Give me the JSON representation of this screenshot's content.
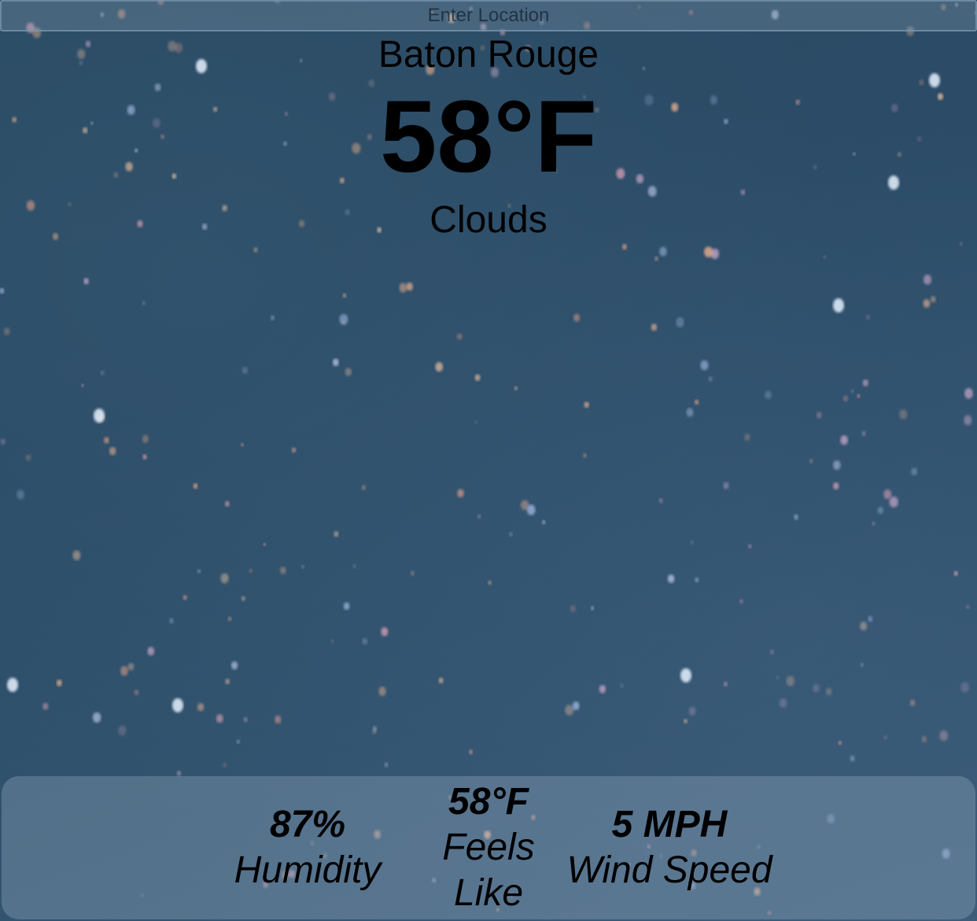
{
  "search": {
    "placeholder": "Enter Location",
    "value": ""
  },
  "weather": {
    "city": "Baton Rouge",
    "temperature": "58°F",
    "description": "Clouds"
  },
  "details": {
    "humidity": {
      "value": "87%",
      "label": "Humidity"
    },
    "feels_like": {
      "value": "58°F",
      "label": "Feels Like"
    },
    "wind": {
      "value": "5 MPH",
      "label": "Wind Speed"
    }
  },
  "colors": {
    "background": "#2b4b66",
    "panel": "#afc3d7",
    "text": "#000000"
  }
}
